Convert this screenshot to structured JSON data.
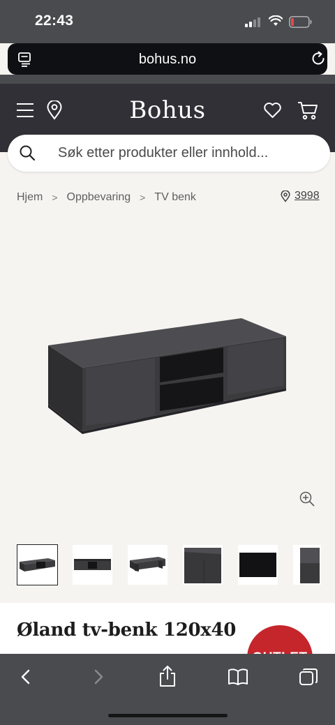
{
  "status_bar": {
    "time": "22:43"
  },
  "browser": {
    "url": "bohus.no"
  },
  "header": {
    "logo": "Bohus"
  },
  "search": {
    "placeholder": "Søk etter produkter eller innhold..."
  },
  "breadcrumb": {
    "items": [
      "Hjem",
      "Oppbevaring",
      "TV benk"
    ],
    "store_number": "3998"
  },
  "product": {
    "title": "Øland tv-benk 120x40",
    "badge": "OUTLET",
    "thumbnail_count": 6
  },
  "colors": {
    "header_bg": "#303036",
    "status_bg": "#4a4b4f",
    "page_bg": "#f5f4f1",
    "badge_red": "#c5262c",
    "furniture": "#3d3d40"
  },
  "icons": {
    "status": [
      "signal-icon",
      "wifi-icon",
      "battery-icon"
    ],
    "browser": [
      "reader-icon",
      "reload-icon"
    ],
    "header": [
      "menu-icon",
      "location-pin-icon",
      "heart-icon",
      "cart-icon"
    ],
    "safari": [
      "back-icon",
      "forward-icon",
      "share-icon",
      "bookmarks-icon",
      "tabs-icon"
    ]
  }
}
